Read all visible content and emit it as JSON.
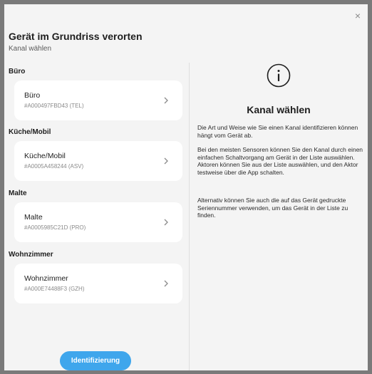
{
  "dialog": {
    "close_symbol": "×",
    "title": "Gerät im Grundriss verorten",
    "subtitle": "Kanal wählen"
  },
  "groups": [
    {
      "header": "Büro",
      "item": {
        "name": "Büro",
        "id": "#A000497FBD43 (TEL)"
      }
    },
    {
      "header": "Küche/Mobil",
      "item": {
        "name": "Küche/Mobil",
        "id": "#A0005A458244 (ASV)"
      }
    },
    {
      "header": "Malte",
      "item": {
        "name": "Malte",
        "id": "#A0005985C21D (PRO)"
      }
    },
    {
      "header": "Wohnzimmer",
      "item": {
        "name": "Wohnzimmer",
        "id": "#A000E74488F3 (GZH)"
      }
    }
  ],
  "footer": {
    "identify_label": "Identifizierung"
  },
  "info": {
    "icon": "info-icon",
    "title": "Kanal wählen",
    "paragraphs": [
      "Die Art und Weise wie Sie einen Kanal identifizieren können hängt vom Gerät ab.",
      "Bei den meisten Sensoren können Sie den Kanal durch einen einfachen Schaltvorgang am Gerät in der Liste auswählen. Aktoren können Sie aus der Liste auswählen, und den Aktor testweise über die App schalten.",
      "Alternativ können Sie auch die auf das Gerät gedruckte Seriennummer verwenden, um das Gerät in der Liste zu finden."
    ]
  },
  "colors": {
    "accent": "#3fa6ec",
    "dialog_background": "#f4f4f4",
    "card_background": "#ffffff",
    "backdrop": "#7a7a7a"
  }
}
